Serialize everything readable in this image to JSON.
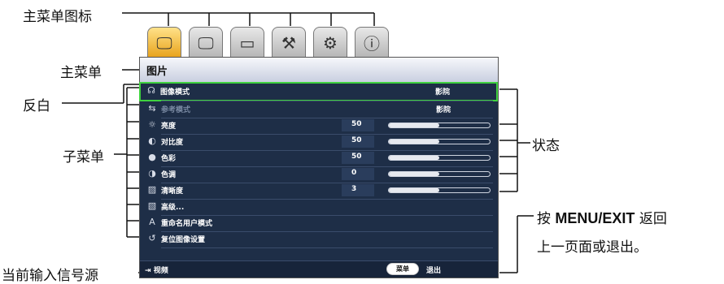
{
  "annotations": {
    "main_menu_icon": "主菜单图标",
    "main_menu": "主菜单",
    "highlight": "反白",
    "submenu": "子菜单",
    "status": "状态",
    "menu_exit_prefix": "按 ",
    "menu_exit_key": "MENU/EXIT",
    "menu_exit_suffix": " 返回",
    "menu_exit_line2": "上一页面或退出。",
    "current_input": "当前输入信号源"
  },
  "tabs": [
    {
      "icon": "picture-icon",
      "active": true
    },
    {
      "icon": "advanced-picture-icon",
      "active": false
    },
    {
      "icon": "display-icon",
      "active": false
    },
    {
      "icon": "system-setup-basic-icon",
      "active": false
    },
    {
      "icon": "system-setup-advanced-icon",
      "active": false
    },
    {
      "icon": "information-icon",
      "active": false
    }
  ],
  "osd": {
    "title": "图片",
    "rows": [
      {
        "label": "图像模式",
        "value": "影院",
        "selected": true,
        "icon": "picture-mode-icon"
      },
      {
        "label": "参考模式",
        "value": "影院",
        "dim": true,
        "icon": "reference-mode-icon"
      },
      {
        "label": "亮度",
        "number": "50",
        "level": 0.5,
        "icon": "brightness-icon"
      },
      {
        "label": "对比度",
        "number": "50",
        "level": 0.5,
        "icon": "contrast-icon"
      },
      {
        "label": "色彩",
        "number": "50",
        "level": 0.5,
        "icon": "color-icon"
      },
      {
        "label": "色调",
        "number": "0",
        "level": 0.5,
        "icon": "tint-icon"
      },
      {
        "label": "清晰度",
        "number": "3",
        "level": 0.5,
        "icon": "sharpness-icon"
      },
      {
        "label": "高级...",
        "icon": "advanced-icon"
      },
      {
        "label": "重命名用户模式",
        "icon": "rename-user-mode-icon"
      },
      {
        "label": "复位图像设置",
        "icon": "reset-picture-icon"
      }
    ],
    "source": "视频",
    "menu_button": "菜单",
    "exit_label": "退出"
  }
}
